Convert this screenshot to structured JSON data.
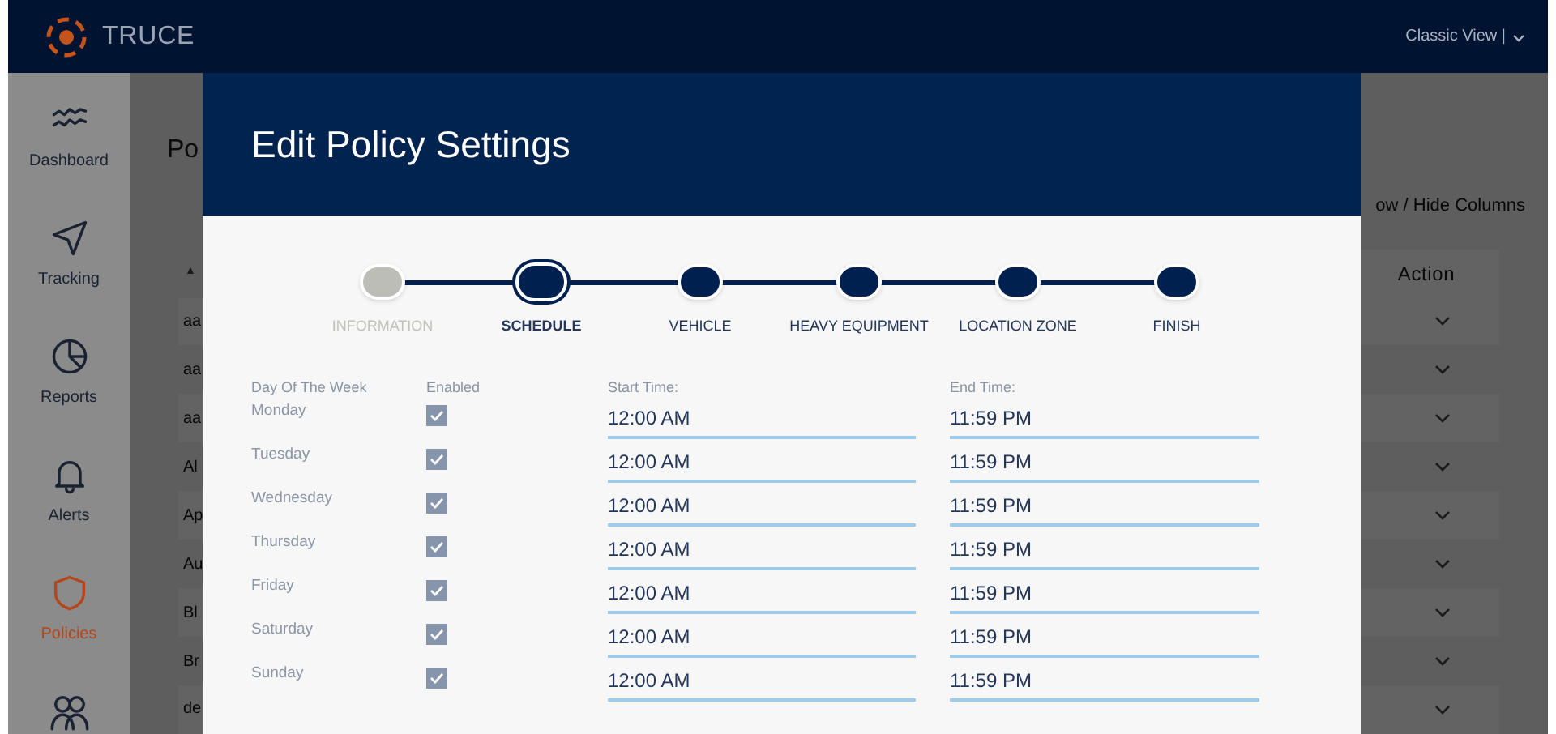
{
  "topbar": {
    "brand": "TRUCE",
    "view_menu": "Classic View |"
  },
  "sidebar": {
    "items": [
      {
        "kind": "dashboard",
        "label": "Dashboard",
        "selected": false
      },
      {
        "kind": "tracking",
        "label": "Tracking",
        "selected": false
      },
      {
        "kind": "reports",
        "label": "Reports",
        "selected": false
      },
      {
        "kind": "alerts",
        "label": "Alerts",
        "selected": false
      },
      {
        "kind": "policies",
        "label": "Policies",
        "selected": true
      },
      {
        "kind": "users",
        "selected": false
      }
    ]
  },
  "page": {
    "title": "Po",
    "sort_arrow": "▲",
    "columns_toggle": "ow / Hide Columns",
    "action_header": "Action",
    "rows": [
      "aa",
      "aa",
      "aa",
      "Al",
      "Ap",
      "Au",
      "Bl",
      "Br",
      "de"
    ]
  },
  "modal": {
    "title": "Edit Policy Settings",
    "steps": [
      {
        "label": "INFORMATION",
        "kind": "done"
      },
      {
        "label": "SCHEDULE",
        "kind": "current"
      },
      {
        "label": "VEHICLE",
        "kind": "upcoming"
      },
      {
        "label": "HEAVY EQUIPMENT",
        "kind": "upcoming"
      },
      {
        "label": "LOCATION ZONE",
        "kind": "upcoming"
      },
      {
        "label": "FINISH",
        "kind": "upcoming"
      }
    ],
    "columns": [
      "Day Of The Week",
      "Enabled",
      "Start Time:",
      "End Time:"
    ],
    "days": [
      {
        "day": "Monday",
        "enabled": true,
        "start": "12:00 AM",
        "end": "11:59 PM"
      },
      {
        "day": "Tuesday",
        "enabled": true,
        "start": "12:00 AM",
        "end": "11:59 PM"
      },
      {
        "day": "Wednesday",
        "enabled": true,
        "start": "12:00 AM",
        "end": "11:59 PM"
      },
      {
        "day": "Thursday",
        "enabled": true,
        "start": "12:00 AM",
        "end": "11:59 PM"
      },
      {
        "day": "Friday",
        "enabled": true,
        "start": "12:00 AM",
        "end": "11:59 PM"
      },
      {
        "day": "Saturday",
        "enabled": true,
        "start": "12:00 AM",
        "end": "11:59 PM"
      },
      {
        "day": "Sunday",
        "enabled": true,
        "start": "12:00 AM",
        "end": "11:59 PM"
      }
    ]
  }
}
